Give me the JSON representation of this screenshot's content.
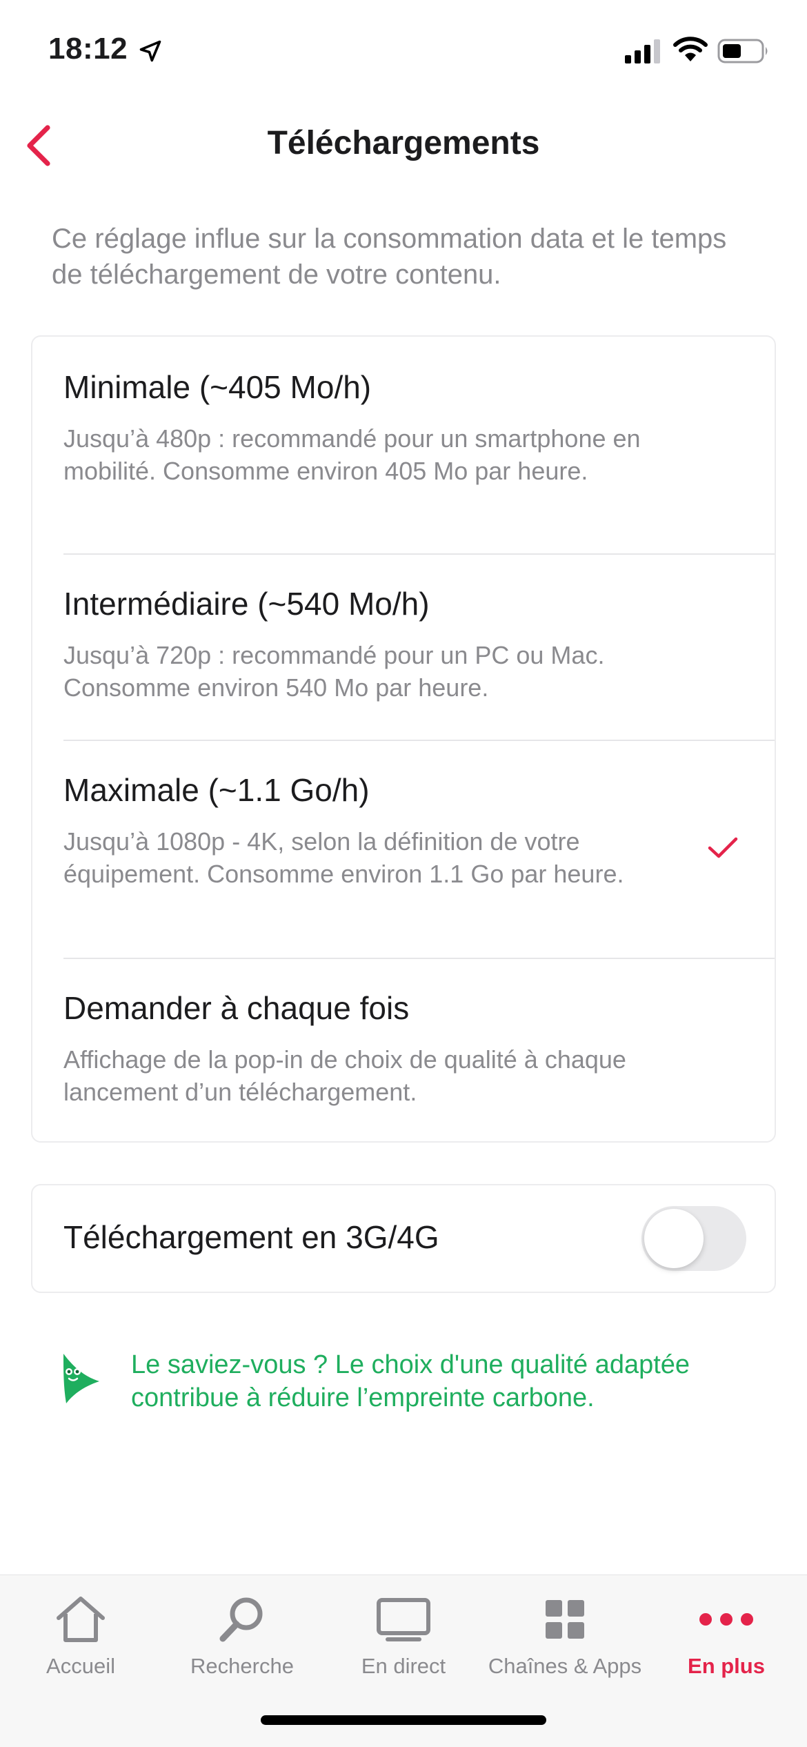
{
  "status_bar": {
    "time": "18:12",
    "icons": [
      "location-arrow-icon",
      "cellular-signal-icon",
      "wifi-icon",
      "battery-icon"
    ]
  },
  "header": {
    "title": "Téléchargements",
    "back_icon": "chevron-left-icon"
  },
  "intro": "Ce réglage influe sur la consommation data et le temps de téléchargement de votre contenu.",
  "quality_options": [
    {
      "title": "Minimale (~405 Mo/h)",
      "description": "Jusqu’à 480p : recommandé pour un smartphone en mobilité. Consomme environ 405 Mo par heure.",
      "selected": false
    },
    {
      "title": "Intermédiaire (~540 Mo/h)",
      "description": "Jusqu’à 720p : recommandé pour un PC ou Mac. Consomme environ 540 Mo par heure.",
      "selected": false
    },
    {
      "title": "Maximale (~1.1 Go/h)",
      "description": "Jusqu’à 1080p - 4K, selon la définition de votre équipement. Consomme environ 1.1 Go par heure.",
      "selected": true
    },
    {
      "title": "Demander à chaque fois",
      "description": "Affichage de la pop-in de choix de qualité à chaque lancement d’un téléchargement.",
      "selected": false
    }
  ],
  "cellular_download": {
    "label": "Téléchargement en 3G/4G",
    "enabled": false
  },
  "tip": {
    "icon": "leaf-icon",
    "text": "Le saviez-vous ? Le choix d'une qualité adaptée contribue à réduire l’empreinte carbone."
  },
  "tab_bar": {
    "items": [
      {
        "label": "Accueil",
        "icon": "home-icon",
        "active": false
      },
      {
        "label": "Recherche",
        "icon": "search-icon",
        "active": false
      },
      {
        "label": "En direct",
        "icon": "tv-icon",
        "active": false
      },
      {
        "label": "Chaînes & Apps",
        "icon": "grid-icon",
        "active": false
      },
      {
        "label": "En plus",
        "icon": "more-dots-icon",
        "active": true
      }
    ]
  },
  "colors": {
    "accent": "#e4234a",
    "tip_green": "#1fae5e",
    "secondary_text": "#8a8a8e"
  }
}
